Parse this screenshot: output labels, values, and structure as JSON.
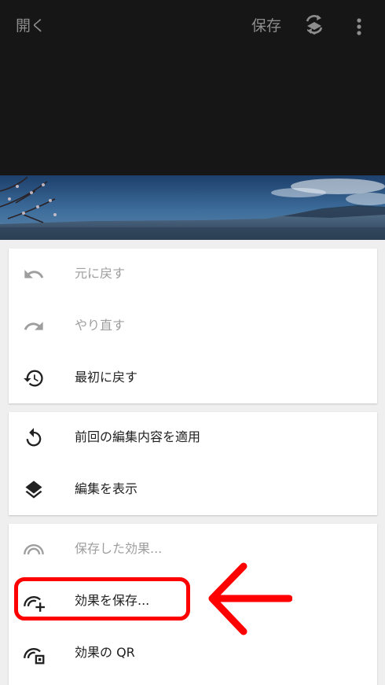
{
  "topbar": {
    "open_label": "開く",
    "save_label": "保存",
    "layers_icon": "layers-swap-icon",
    "more_icon": "more-vertical-icon"
  },
  "menu": {
    "groups": [
      {
        "items": [
          {
            "label": "元に戻す",
            "icon": "undo-icon",
            "enabled": false
          },
          {
            "label": "やり直す",
            "icon": "redo-icon",
            "enabled": false
          },
          {
            "label": "最初に戻す",
            "icon": "history-icon",
            "enabled": true
          }
        ]
      },
      {
        "items": [
          {
            "label": "前回の編集内容を適用",
            "icon": "replay-icon",
            "enabled": true
          },
          {
            "label": "編集を表示",
            "icon": "layers-icon",
            "enabled": true
          }
        ]
      },
      {
        "items": [
          {
            "label": "保存した効果...",
            "icon": "looks-icon",
            "enabled": false
          },
          {
            "label": "効果を保存...",
            "icon": "looks-add-icon",
            "enabled": true
          },
          {
            "label": "効果の QR",
            "icon": "looks-qr-icon",
            "enabled": true
          }
        ]
      }
    ]
  },
  "colors": {
    "topbar_bg": "#161616",
    "highlight": "#ff0000",
    "disabled_text": "#9e9e9e",
    "text": "#212121"
  }
}
